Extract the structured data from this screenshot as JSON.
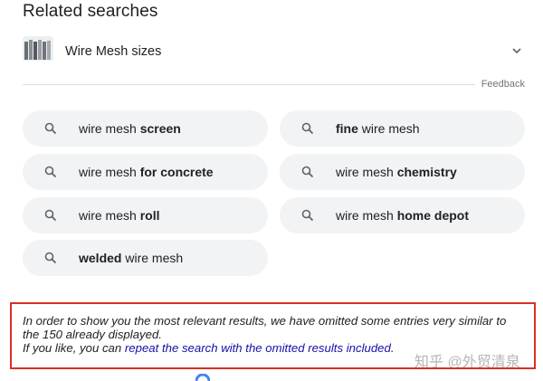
{
  "section_title": "Related searches",
  "accordion": {
    "label": "Wire Mesh sizes",
    "icon": "chevron-down-icon"
  },
  "feedback_label": "Feedback",
  "chips": [
    {
      "pre": "wire mesh ",
      "bold": "screen",
      "post": ""
    },
    {
      "pre": "",
      "bold": "fine",
      "post": " wire mesh"
    },
    {
      "pre": "wire mesh ",
      "bold": "for concrete",
      "post": ""
    },
    {
      "pre": "wire mesh ",
      "bold": "chemistry",
      "post": ""
    },
    {
      "pre": "wire mesh ",
      "bold": "roll",
      "post": ""
    },
    {
      "pre": "wire mesh ",
      "bold": "home depot",
      "post": ""
    },
    {
      "pre": "",
      "bold": "welded",
      "post": " wire mesh"
    }
  ],
  "notice": {
    "line1": "In order to show you the most relevant results, we have omitted some entries very similar to the 150 already displayed.",
    "line2_pre": "If you like, you can ",
    "line2_link": "repeat the search with the omitted results included",
    "line2_post": "."
  },
  "watermark": "知乎 @外贸清泉",
  "colors": {
    "highlight_border": "#d93025",
    "link": "#1a0dab",
    "chip_bg": "#f1f3f4"
  }
}
